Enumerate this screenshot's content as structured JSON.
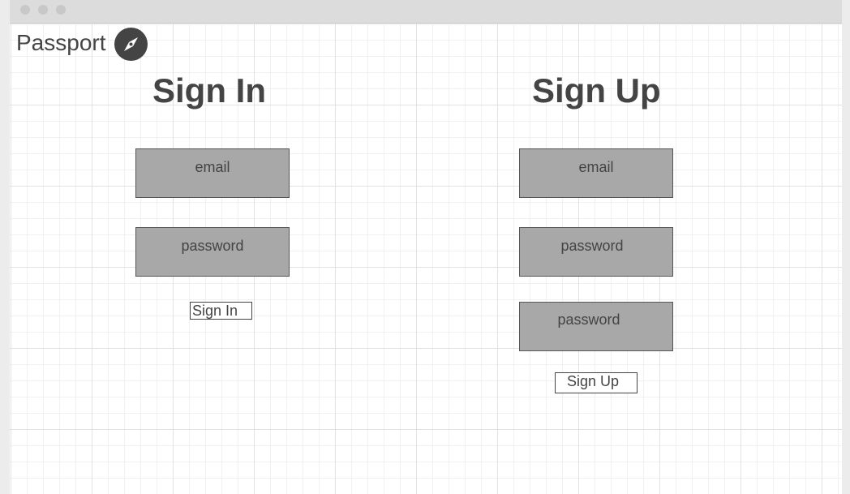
{
  "app": {
    "title": "Passport",
    "logo_icon": "compass-icon"
  },
  "signin": {
    "heading": "Sign In",
    "email_placeholder": "email",
    "password_placeholder": "password",
    "button_label": "Sign In"
  },
  "signup": {
    "heading": "Sign Up",
    "email_placeholder": "email",
    "password_placeholder": "password",
    "confirm_password_placeholder": "password",
    "button_label": "Sign Up"
  },
  "colors": {
    "field_bg": "#a8a8a8",
    "text": "#444444",
    "titlebar": "#dcdcdc"
  }
}
